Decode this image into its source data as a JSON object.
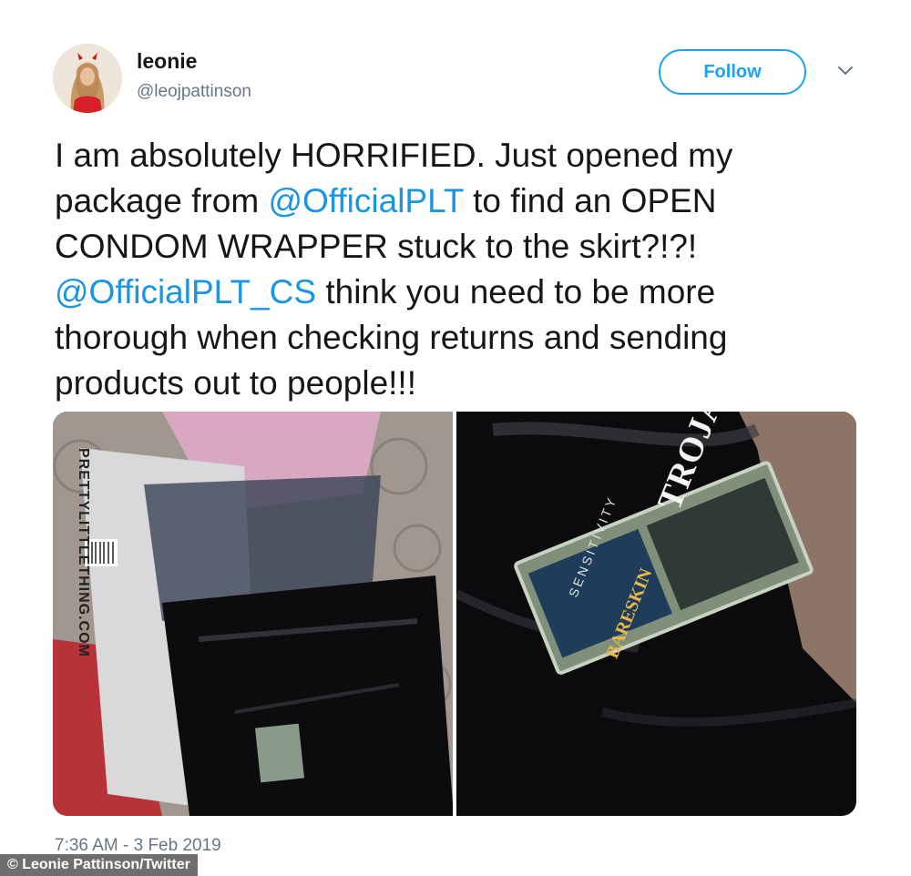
{
  "user": {
    "display_name": "leonie",
    "handle": "@leojpattinson",
    "avatar_icon": "profile-photo"
  },
  "actions": {
    "follow_label": "Follow",
    "menu_icon": "chevron-down-icon"
  },
  "tweet": {
    "segments": [
      {
        "text": "I am absolutely HORRIFIED. Just opened my\npackage from ",
        "type": "text"
      },
      {
        "text": "@OfficialPLT",
        "type": "mention"
      },
      {
        "text": " to find an OPEN\nCONDOM WRAPPER stuck to the skirt?!?!\n",
        "type": "text"
      },
      {
        "text": "@OfficialPLT_CS",
        "type": "mention"
      },
      {
        "text": " think you need to be more\nthorough when checking returns and sending\nproducts out to people!!!",
        "type": "text"
      }
    ],
    "timestamp": "7:36 AM - 3 Feb 2019"
  },
  "media": {
    "photo_left_text": "PRETTYLITTLETHING.COM",
    "photo_right_brand": "TROJAN",
    "photo_right_line": "BARESKIN",
    "photo_right_sub": "SENSITIVITY"
  },
  "credit": "© Leonie Pattinson/Twitter",
  "colors": {
    "accent": "#1da1f2",
    "mention": "#1b95e0",
    "secondary_text": "#657786"
  }
}
